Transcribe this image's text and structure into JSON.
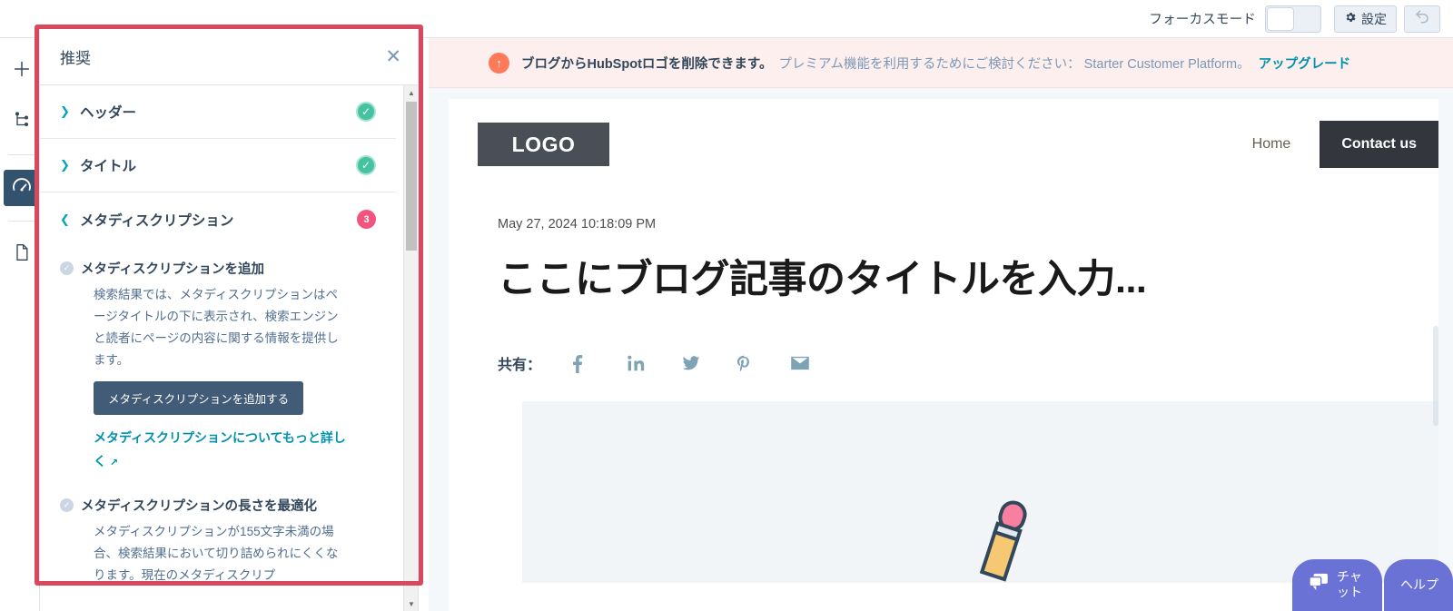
{
  "topbar": {
    "focus_mode_label": "フォーカスモード",
    "focus_mode_state": "off",
    "settings_label": "設定",
    "settings_icon": "gear-icon",
    "undo_icon": "undo-arrow-icon"
  },
  "rail": {
    "items": [
      {
        "icon": "plus-icon",
        "name": "add"
      },
      {
        "icon": "sitemap-icon",
        "name": "content-tree"
      },
      {
        "icon": "gauge-icon",
        "name": "optimize",
        "active": true
      },
      {
        "icon": "document-icon",
        "name": "page-details"
      }
    ]
  },
  "panel": {
    "title": "推奨",
    "close_icon": "close-icon",
    "sections": [
      {
        "label": "ヘッダー",
        "status": "ok",
        "expanded": false,
        "chevron": "chevron-right-icon"
      },
      {
        "label": "タイトル",
        "status": "ok",
        "expanded": false,
        "chevron": "chevron-right-icon"
      },
      {
        "label": "メタディスクリプション",
        "status": "count",
        "count": "3",
        "expanded": true,
        "chevron": "chevron-down-icon"
      }
    ],
    "items": [
      {
        "title": "メタディスクリプションを追加",
        "description": "検索結果では、メタディスクリプションはページタイトルの下に表示され、検索エンジンと読者にページの内容に関する情報を提供します。",
        "button": "メタディスクリプションを追加する",
        "link": "メタディスクリプションについてもっと詳しく",
        "link_icon": "external-link-icon"
      },
      {
        "title": "メタディスクリプションの長さを最適化",
        "description": "メタディスクリプションが155文字未満の場合、検索結果において切り詰められにくくなります。現在のメタディスクリプ"
      }
    ]
  },
  "alert": {
    "icon": "upgrade-arrow-icon",
    "strong_text": "ブログからHubSpotロゴを削除できます。",
    "normal_text": "プレミアム機能を利用するためにご検討ください： Starter Customer Platform。",
    "link_text": "アップグレード"
  },
  "preview": {
    "logo": "LOGO",
    "nav_link": "Home",
    "nav_cta": "Contact us",
    "post_date": "May 27, 2024 10:18:09 PM",
    "post_title": "ここにブログ記事のタイトルを入力...",
    "share_label": "共有：",
    "share_icons": [
      {
        "name": "facebook-icon",
        "glyph": "f"
      },
      {
        "name": "linkedin-icon",
        "glyph": "in"
      },
      {
        "name": "twitter-icon",
        "glyph": ""
      },
      {
        "name": "pinterest-icon",
        "glyph": ""
      },
      {
        "name": "email-icon",
        "glyph": ""
      }
    ]
  },
  "chat": {
    "chat_label": "チャット",
    "help_label": "ヘルプ",
    "chat_icon": "chat-bubble-icon"
  },
  "colors": {
    "accent_red": "#d9495e",
    "link_blue": "#0091ae",
    "brand_orange": "#ff7a59",
    "ok_green": "#45c2a0",
    "badge_pink": "#f2547d",
    "dark_navy": "#33475b",
    "chat_purple": "#6b72d6"
  }
}
